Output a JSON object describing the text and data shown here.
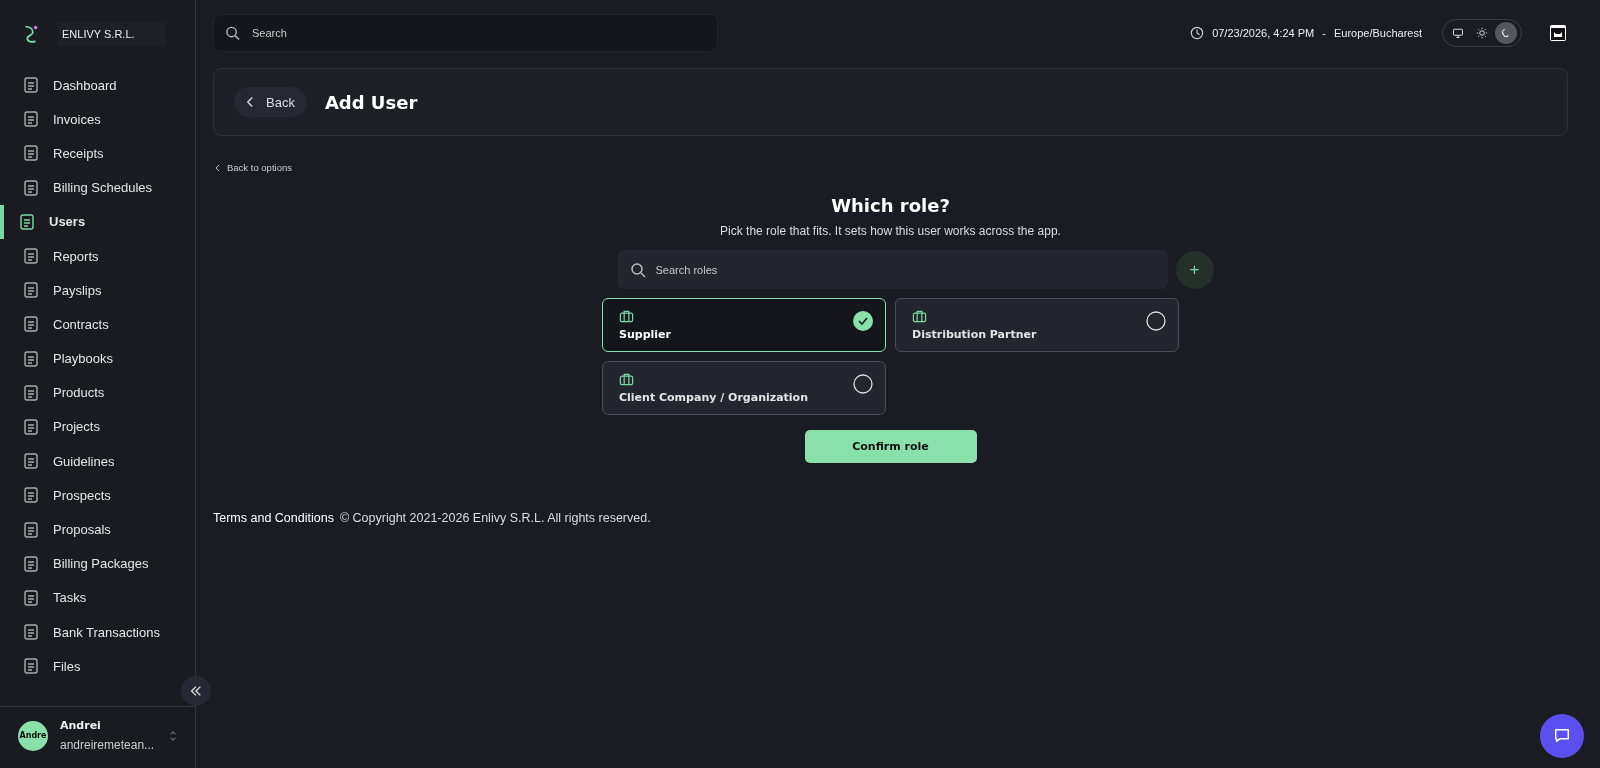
{
  "sidebar": {
    "company": "ENLIVY S.R.L.",
    "items": [
      {
        "label": "Dashboard",
        "selected": false
      },
      {
        "label": "Invoices",
        "selected": false
      },
      {
        "label": "Receipts",
        "selected": false
      },
      {
        "label": "Billing Schedules",
        "selected": false
      },
      {
        "label": "Users",
        "selected": true
      },
      {
        "label": "Reports",
        "selected": false
      },
      {
        "label": "Payslips",
        "selected": false
      },
      {
        "label": "Contracts",
        "selected": false
      },
      {
        "label": "Playbooks",
        "selected": false
      },
      {
        "label": "Products",
        "selected": false
      },
      {
        "label": "Projects",
        "selected": false
      },
      {
        "label": "Guidelines",
        "selected": false
      },
      {
        "label": "Prospects",
        "selected": false
      },
      {
        "label": "Proposals",
        "selected": false
      },
      {
        "label": "Billing Packages",
        "selected": false
      },
      {
        "label": "Tasks",
        "selected": false
      },
      {
        "label": "Bank Transactions",
        "selected": false
      },
      {
        "label": "Files",
        "selected": false
      }
    ],
    "user": {
      "avatar_text": "Andre",
      "name": "Andrei",
      "email": "andreiremetean..."
    }
  },
  "topbar": {
    "search": {
      "placeholder": "Search"
    },
    "datetime": "07/23/2026, 4:24 PM",
    "separator": "-",
    "timezone": "Europe/Bucharest",
    "theme_modes": [
      {
        "kind": "system",
        "selected": false
      },
      {
        "kind": "light",
        "selected": false
      },
      {
        "kind": "dark",
        "selected": true
      }
    ]
  },
  "header": {
    "back": "Back",
    "title": "Add User"
  },
  "back_link": "Back to options",
  "role_picker": {
    "title": "Which role?",
    "subtitle": "Pick the role that fits. It sets how this user works across the app.",
    "search": {
      "placeholder": "Search roles"
    },
    "add_button": "+",
    "roles": [
      {
        "label": "Supplier",
        "selected": true
      },
      {
        "label": "Distribution Partner",
        "selected": false
      },
      {
        "label": "Client Company / Organization",
        "selected": false
      }
    ],
    "confirm": "Confirm role"
  },
  "footer": {
    "terms": "Terms and Conditions",
    "copyright": "© Copyright 2021-2026 Enlivy S.R.L. All rights reserved."
  }
}
